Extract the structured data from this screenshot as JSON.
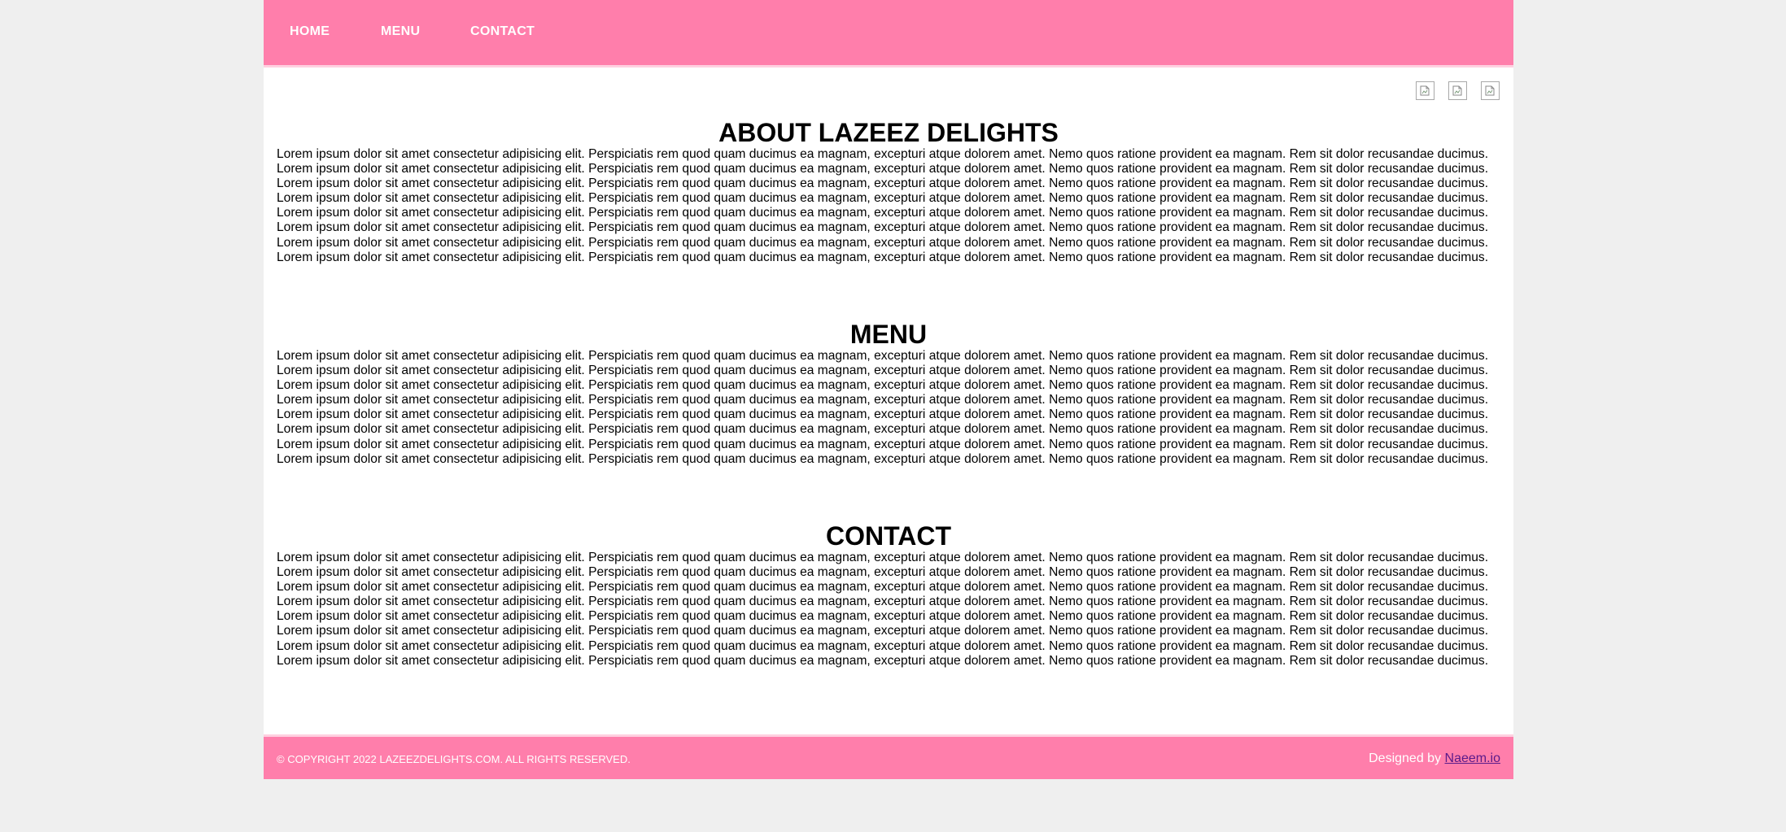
{
  "nav": {
    "items": [
      {
        "label": "HOME"
      },
      {
        "label": "MENU"
      },
      {
        "label": "CONTACT"
      }
    ]
  },
  "social": {
    "icons": [
      "broken-image-icon",
      "broken-image-icon",
      "broken-image-icon"
    ]
  },
  "sections": [
    {
      "title": "ABOUT LAZEEZ DELIGHTS",
      "text": "Lorem ipsum dolor sit amet consectetur adipisicing elit. Perspiciatis rem quod quam ducimus ea magnam, excepturi atque dolorem amet. Nemo quos ratione provident ea magnam. Rem sit dolor recusandae ducimus. Lorem ipsum dolor sit amet consectetur adipisicing elit. Perspiciatis rem quod quam ducimus ea magnam, excepturi atque dolorem amet. Nemo quos ratione provident ea magnam. Rem sit dolor recusandae ducimus. Lorem ipsum dolor sit amet consectetur adipisicing elit. Perspiciatis rem quod quam ducimus ea magnam, excepturi atque dolorem amet. Nemo quos ratione provident ea magnam. Rem sit dolor recusandae ducimus. Lorem ipsum dolor sit amet consectetur adipisicing elit. Perspiciatis rem quod quam ducimus ea magnam, excepturi atque dolorem amet. Nemo quos ratione provident ea magnam. Rem sit dolor recusandae ducimus. Lorem ipsum dolor sit amet consectetur adipisicing elit. Perspiciatis rem quod quam ducimus ea magnam, excepturi atque dolorem amet. Nemo quos ratione provident ea magnam. Rem sit dolor recusandae ducimus. Lorem ipsum dolor sit amet consectetur adipisicing elit. Perspiciatis rem quod quam ducimus ea magnam, excepturi atque dolorem amet. Nemo quos ratione provident ea magnam. Rem sit dolor recusandae ducimus. Lorem ipsum dolor sit amet consectetur adipisicing elit. Perspiciatis rem quod quam ducimus ea magnam, excepturi atque dolorem amet. Nemo quos ratione provident ea magnam. Rem sit dolor recusandae ducimus. Lorem ipsum dolor sit amet consectetur adipisicing elit. Perspiciatis rem quod quam ducimus ea magnam, excepturi atque dolorem amet. Nemo quos ratione provident ea magnam. Rem sit dolor recusandae ducimus."
    },
    {
      "title": "MENU",
      "text": "Lorem ipsum dolor sit amet consectetur adipisicing elit. Perspiciatis rem quod quam ducimus ea magnam, excepturi atque dolorem amet. Nemo quos ratione provident ea magnam. Rem sit dolor recusandae ducimus. Lorem ipsum dolor sit amet consectetur adipisicing elit. Perspiciatis rem quod quam ducimus ea magnam, excepturi atque dolorem amet. Nemo quos ratione provident ea magnam. Rem sit dolor recusandae ducimus. Lorem ipsum dolor sit amet consectetur adipisicing elit. Perspiciatis rem quod quam ducimus ea magnam, excepturi atque dolorem amet. Nemo quos ratione provident ea magnam. Rem sit dolor recusandae ducimus. Lorem ipsum dolor sit amet consectetur adipisicing elit. Perspiciatis rem quod quam ducimus ea magnam, excepturi atque dolorem amet. Nemo quos ratione provident ea magnam. Rem sit dolor recusandae ducimus. Lorem ipsum dolor sit amet consectetur adipisicing elit. Perspiciatis rem quod quam ducimus ea magnam, excepturi atque dolorem amet. Nemo quos ratione provident ea magnam. Rem sit dolor recusandae ducimus. Lorem ipsum dolor sit amet consectetur adipisicing elit. Perspiciatis rem quod quam ducimus ea magnam, excepturi atque dolorem amet. Nemo quos ratione provident ea magnam. Rem sit dolor recusandae ducimus. Lorem ipsum dolor sit amet consectetur adipisicing elit. Perspiciatis rem quod quam ducimus ea magnam, excepturi atque dolorem amet. Nemo quos ratione provident ea magnam. Rem sit dolor recusandae ducimus. Lorem ipsum dolor sit amet consectetur adipisicing elit. Perspiciatis rem quod quam ducimus ea magnam, excepturi atque dolorem amet. Nemo quos ratione provident ea magnam. Rem sit dolor recusandae ducimus."
    },
    {
      "title": "CONTACT",
      "text": "Lorem ipsum dolor sit amet consectetur adipisicing elit. Perspiciatis rem quod quam ducimus ea magnam, excepturi atque dolorem amet. Nemo quos ratione provident ea magnam. Rem sit dolor recusandae ducimus. Lorem ipsum dolor sit amet consectetur adipisicing elit. Perspiciatis rem quod quam ducimus ea magnam, excepturi atque dolorem amet. Nemo quos ratione provident ea magnam. Rem sit dolor recusandae ducimus. Lorem ipsum dolor sit amet consectetur adipisicing elit. Perspiciatis rem quod quam ducimus ea magnam, excepturi atque dolorem amet. Nemo quos ratione provident ea magnam. Rem sit dolor recusandae ducimus. Lorem ipsum dolor sit amet consectetur adipisicing elit. Perspiciatis rem quod quam ducimus ea magnam, excepturi atque dolorem amet. Nemo quos ratione provident ea magnam. Rem sit dolor recusandae ducimus. Lorem ipsum dolor sit amet consectetur adipisicing elit. Perspiciatis rem quod quam ducimus ea magnam, excepturi atque dolorem amet. Nemo quos ratione provident ea magnam. Rem sit dolor recusandae ducimus. Lorem ipsum dolor sit amet consectetur adipisicing elit. Perspiciatis rem quod quam ducimus ea magnam, excepturi atque dolorem amet. Nemo quos ratione provident ea magnam. Rem sit dolor recusandae ducimus. Lorem ipsum dolor sit amet consectetur adipisicing elit. Perspiciatis rem quod quam ducimus ea magnam, excepturi atque dolorem amet. Nemo quos ratione provident ea magnam. Rem sit dolor recusandae ducimus. Lorem ipsum dolor sit amet consectetur adipisicing elit. Perspiciatis rem quod quam ducimus ea magnam, excepturi atque dolorem amet. Nemo quos ratione provident ea magnam. Rem sit dolor recusandae ducimus."
    }
  ],
  "footer": {
    "copyright": "© COPYRIGHT 2022 LAZEEZDELIGHTS.COM. ALL RIGHTS RESERVED.",
    "designed_prefix": "Designed by ",
    "designer_link": "Naeem.io"
  },
  "colors": {
    "brand_pink": "#ff7eab",
    "border_light_pink": "#ffd0e0",
    "background": "#efefef",
    "link": "#5a1a8a"
  }
}
